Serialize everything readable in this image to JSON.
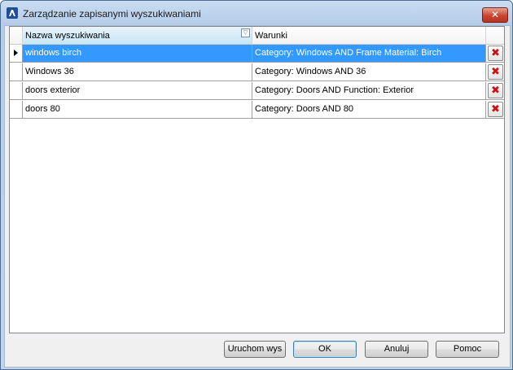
{
  "window": {
    "title": "Zarządzanie zapisanymi wyszukiwaniami",
    "close_glyph": "✕"
  },
  "grid": {
    "columns": [
      "Nazwa wyszukiwania",
      "Warunki"
    ],
    "filter_icon": "filter-icon",
    "delete_icon": "delete-x-icon",
    "rows": [
      {
        "name": "windows birch",
        "conditions": "Category: Windows AND Frame Material: Birch",
        "selected": true
      },
      {
        "name": "Windows 36",
        "conditions": "Category: Windows AND 36",
        "selected": false
      },
      {
        "name": "doors exterior",
        "conditions": "Category: Doors AND Function: Exterior",
        "selected": false
      },
      {
        "name": "doors 80",
        "conditions": "Category: Doors AND 80",
        "selected": false
      }
    ]
  },
  "buttons": {
    "run": "Uruchom wys",
    "ok": "OK",
    "cancel": "Anuluj",
    "help": "Pomoc"
  },
  "colors": {
    "selection": "#3399ff",
    "delete": "#d01010"
  }
}
